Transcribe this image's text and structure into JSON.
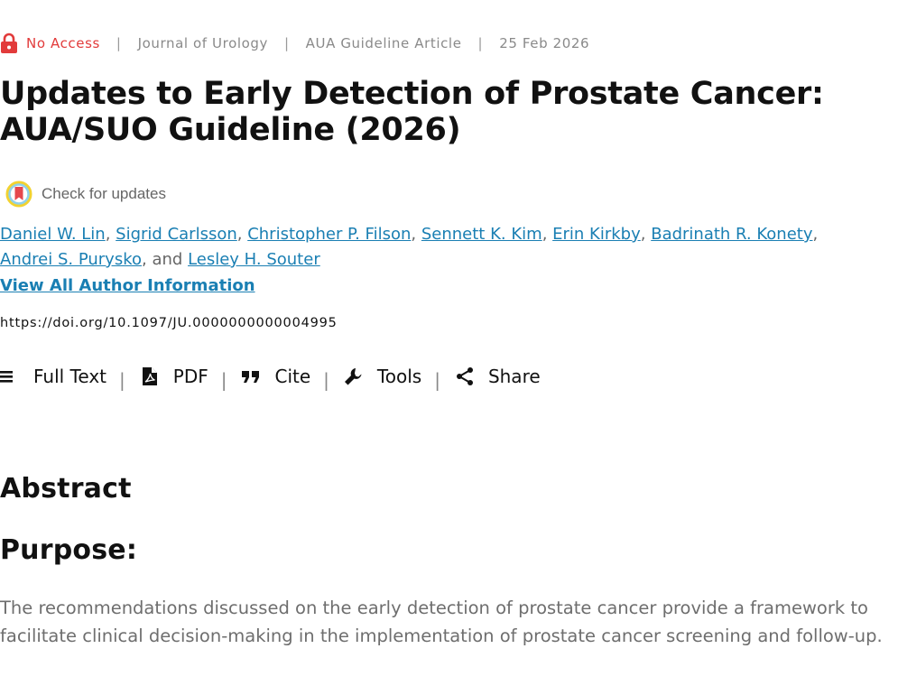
{
  "meta": {
    "access": "No Access",
    "journal": "Journal of Urology",
    "article_type": "AUA Guideline Article",
    "date": "25 Feb 2026",
    "separator": "|",
    "access_color": "#e23b3b"
  },
  "article": {
    "title": "Updates to Early Detection of Prostate Cancer: AUA/SUO Guideline (2026)",
    "check_updates": "Check for updates",
    "authors": [
      "Daniel W. Lin",
      "Sigrid Carlsson",
      "Christopher P. Filson",
      "Sennett K. Kim",
      "Erin Kirkby",
      "Badrinath R. Konety",
      "Andrei S. Purysko",
      "Lesley H. Souter"
    ],
    "author_conjunction": "and",
    "view_all": "View All Author Information",
    "doi": "https://doi.org/10.1097/JU.0000000000004995",
    "link_color": "#1a7fb3"
  },
  "toolbar": {
    "full_text": "Full Text",
    "pdf": "PDF",
    "cite": "Cite",
    "tools": "Tools",
    "share": "Share",
    "icons": [
      "list-icon",
      "pdf-icon",
      "quote-icon",
      "wrench-icon",
      "share-icon"
    ]
  },
  "abstract": {
    "heading": "Abstract",
    "purpose_heading": "Purpose:",
    "purpose_text": "The recommendations discussed on the early detection of prostate cancer provide a framework to facilitate clinical decision-making in the implementation of prostate cancer screening and follow-up."
  }
}
